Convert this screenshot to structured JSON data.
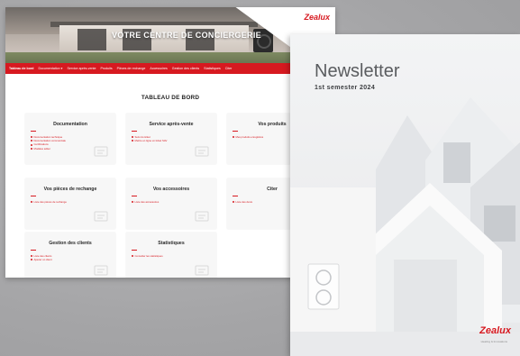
{
  "portal": {
    "hero_title": "VOTRE CENTRE DE CONCIERGERIE",
    "brand": "Zealux",
    "nav": [
      {
        "label": "Tableau de bord",
        "active": true
      },
      {
        "label": "Documentation ▾"
      },
      {
        "label": "Service après-vente"
      },
      {
        "label": "Produits"
      },
      {
        "label": "Pièces de rechange"
      },
      {
        "label": "Accessoires"
      },
      {
        "label": "Gestion des clients"
      },
      {
        "label": "Statistiques"
      },
      {
        "label": "Citer"
      }
    ],
    "dashboard_title": "TABLEAU DE BORD",
    "cards": [
      {
        "title": "Documentation",
        "links": [
          "Documentation technique",
          "Documentation commerciale",
          "Certifications",
          "Modèles éditer"
        ],
        "icon": "document-icon"
      },
      {
        "title": "Service après-vente",
        "links": [
          "Suivi du ticket",
          "Mettre en ligne un ticket SAV"
        ],
        "icon": "wrench-icon"
      },
      {
        "title": "Vos produits",
        "links": [
          "Mes produits enregistrés"
        ],
        "icon": "product-icon"
      },
      {
        "title": "Vos pièces de rechange",
        "links": [
          "Liste des pièces de rechange"
        ],
        "icon": "parts-icon"
      },
      {
        "title": "Vos accessoires",
        "links": [
          "Liste des accessoires"
        ],
        "icon": "accessory-icon"
      },
      {
        "title": "Citer",
        "links": [
          "Liste des devis"
        ],
        "icon": "quote-icon"
      },
      {
        "title": "Gestion des clients",
        "links": [
          "Liste des clients",
          "Ajouter un client"
        ],
        "icon": "clients-icon"
      },
      {
        "title": "Statistiques",
        "links": [
          "Consulter les statistiques"
        ],
        "icon": "chart-icon"
      }
    ]
  },
  "newsletter": {
    "title": "Newsletter",
    "subtitle": "1st semester 2024",
    "brand": "Zealux",
    "tagline": "Heating & Innovations"
  }
}
